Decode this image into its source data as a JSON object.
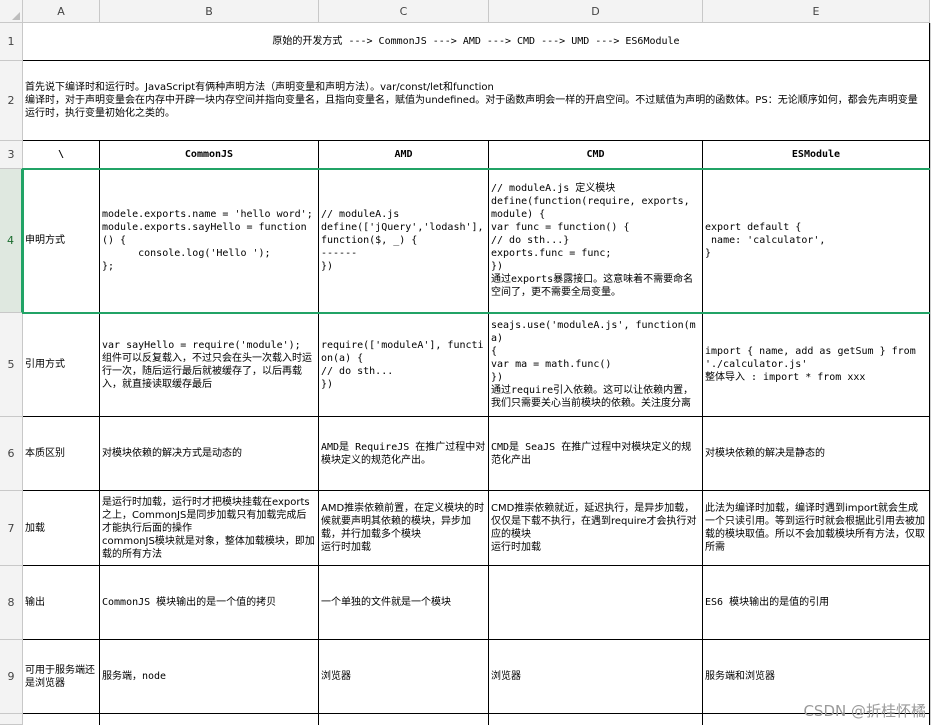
{
  "columns": [
    "A",
    "B",
    "C",
    "D",
    "E"
  ],
  "rows": [
    "1",
    "2",
    "3",
    "4",
    "5",
    "6",
    "7",
    "8",
    "9"
  ],
  "title": "原始的开发方式 ---> CommonJS ---> AMD ---> CMD ---> UMD ---> ES6Module",
  "intro": "首先说下编译时和运行时。JavaScript有俩种声明方法（声明变量和声明方法）。var/const/let和function\n编译时，对于声明变量会在内存中开辟一块内存空间并指向变量名，且指向变量名，赋值为undefined。对于函数声明会一样的开启空间。不过赋值为声明的函数体。PS：无论顺序如何，都会先声明变量\n运行时，执行变量初始化之类的。",
  "headers": [
    "\\",
    "CommonJS",
    "AMD",
    "CMD",
    "ESModule"
  ],
  "table": [
    {
      "label": "申明方式",
      "commonjs": "modele.exports.name = 'hello word';\nmodule.exports.sayHello = function() {\n      console.log('Hello ');\n};",
      "amd": "// moduleA.js\ndefine(['jQuery','lodash'], function($, _) {\n------\n})",
      "cmd": "// moduleA.js 定义模块\ndefine(function(require, exports, module) {\nvar func = function() {\n// do sth...}\nexports.func = func;\n})\n通过exports暴露接口。这意味着不需要命名空间了，更不需要全局变量。",
      "esm": "export default {\n name: 'calculator',\n}"
    },
    {
      "label": "引用方式",
      "commonjs": "var sayHello = require('module');\n组件可以反复载入，不过只会在头一次载入时运行一次，随后运行最后就被缓存了，以后再载入，就直接读取缓存最后",
      "amd": "require(['moduleA'], function(a) {\n// do sth...\n})",
      "cmd": "seajs.use('moduleA.js', function(ma)\n{\nvar ma = math.func()\n})\n通过require引入依赖。这可以让依赖内置，我们只需要关心当前模块的依赖。关注度分离",
      "esm": "import { name, add as getSum } from './calculator.js'\n整体导入 : import * from xxx"
    },
    {
      "label": "本质区别",
      "commonjs": "对模块依赖的解决方式是动态的",
      "amd": "AMD是 RequireJS 在推广过程中对模块定义的规范化产出。",
      "cmd": "CMD是 SeaJS 在推广过程中对模块定义的规范化产出",
      "esm": "对模块依赖的解决是静态的"
    },
    {
      "label": "加载",
      "commonjs": "是运行时加载，运行时才把模块挂载在exports之上，CommonJS是同步加载只有加载完成后才能执行后面的操作\ncommonJS模块就是对象，整体加载模块，即加载的所有方法",
      "amd": "AMD推崇依赖前置，在定义模块的时候就要声明其依赖的模块，异步加载，并行加载多个模块\n运行时加载",
      "cmd": "CMD推崇依赖就近，延迟执行，是异步加载，仅仅是下载不执行，在遇到require才会执行对应的模块\n运行时加载",
      "esm": "此法为编译时加载，编译时遇到import就会生成一个只读引用。等到运行时就会根据此引用去被加载的模块取值。所以不会加载模块所有方法，仅取所需"
    },
    {
      "label": "输出",
      "commonjs": "CommonJS 模块输出的是一个值的拷贝",
      "amd": "一个单独的文件就是一个模块",
      "cmd": "",
      "esm": "ES6 模块输出的是值的引用"
    },
    {
      "label": "可用于服务端还是浏览器",
      "commonjs": "服务端，node",
      "amd": "浏览器",
      "cmd": "浏览器",
      "esm": "服务端和浏览器"
    }
  ],
  "watermark": "CSDN @折桂怀橘"
}
